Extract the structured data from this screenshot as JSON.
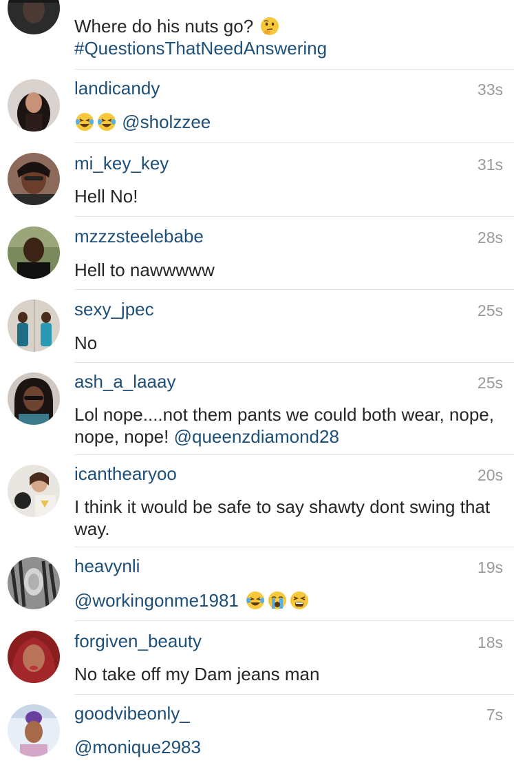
{
  "comments": [
    {
      "text": "Where do his nuts go?",
      "emojis": [
        "thinking-face-icon"
      ],
      "hashtag": "#QuestionsThatNeedAnswering"
    },
    {
      "username": "landicandy",
      "time": "33s",
      "emojis": [
        "laughing-tears-icon",
        "laughing-tears-icon"
      ],
      "mention": "@sholzzee"
    },
    {
      "username": "mi_key_key",
      "time": "31s",
      "text": "Hell No!"
    },
    {
      "username": "mzzzsteelebabe",
      "time": "28s",
      "text": "Hell to nawwwww"
    },
    {
      "username": "sexy_jpec",
      "time": "25s",
      "text": "No"
    },
    {
      "username": "ash_a_laaay",
      "time": "25s",
      "text": "Lol nope....not them pants we could both wear, nope, nope, nope!",
      "mention": "@queenzdiamond28"
    },
    {
      "username": "icanthearyoo",
      "time": "20s",
      "text": "I think it would be safe to say shawty dont swing that way."
    },
    {
      "username": "heavynli",
      "time": "19s",
      "mention": "@workingonme1981",
      "emojis": [
        "laughing-tears-icon",
        "loudly-crying-icon",
        "tired-face-icon"
      ]
    },
    {
      "username": "forgiven_beauty",
      "time": "18s",
      "text": "No take off my Dam jeans man"
    },
    {
      "username": "goodvibeonly_",
      "time": "7s",
      "mention": "@monique2983"
    }
  ],
  "colors": {
    "username": "#1e4f79",
    "text": "#262626",
    "timestamp": "#999999",
    "divider": "#e3e3e3"
  }
}
